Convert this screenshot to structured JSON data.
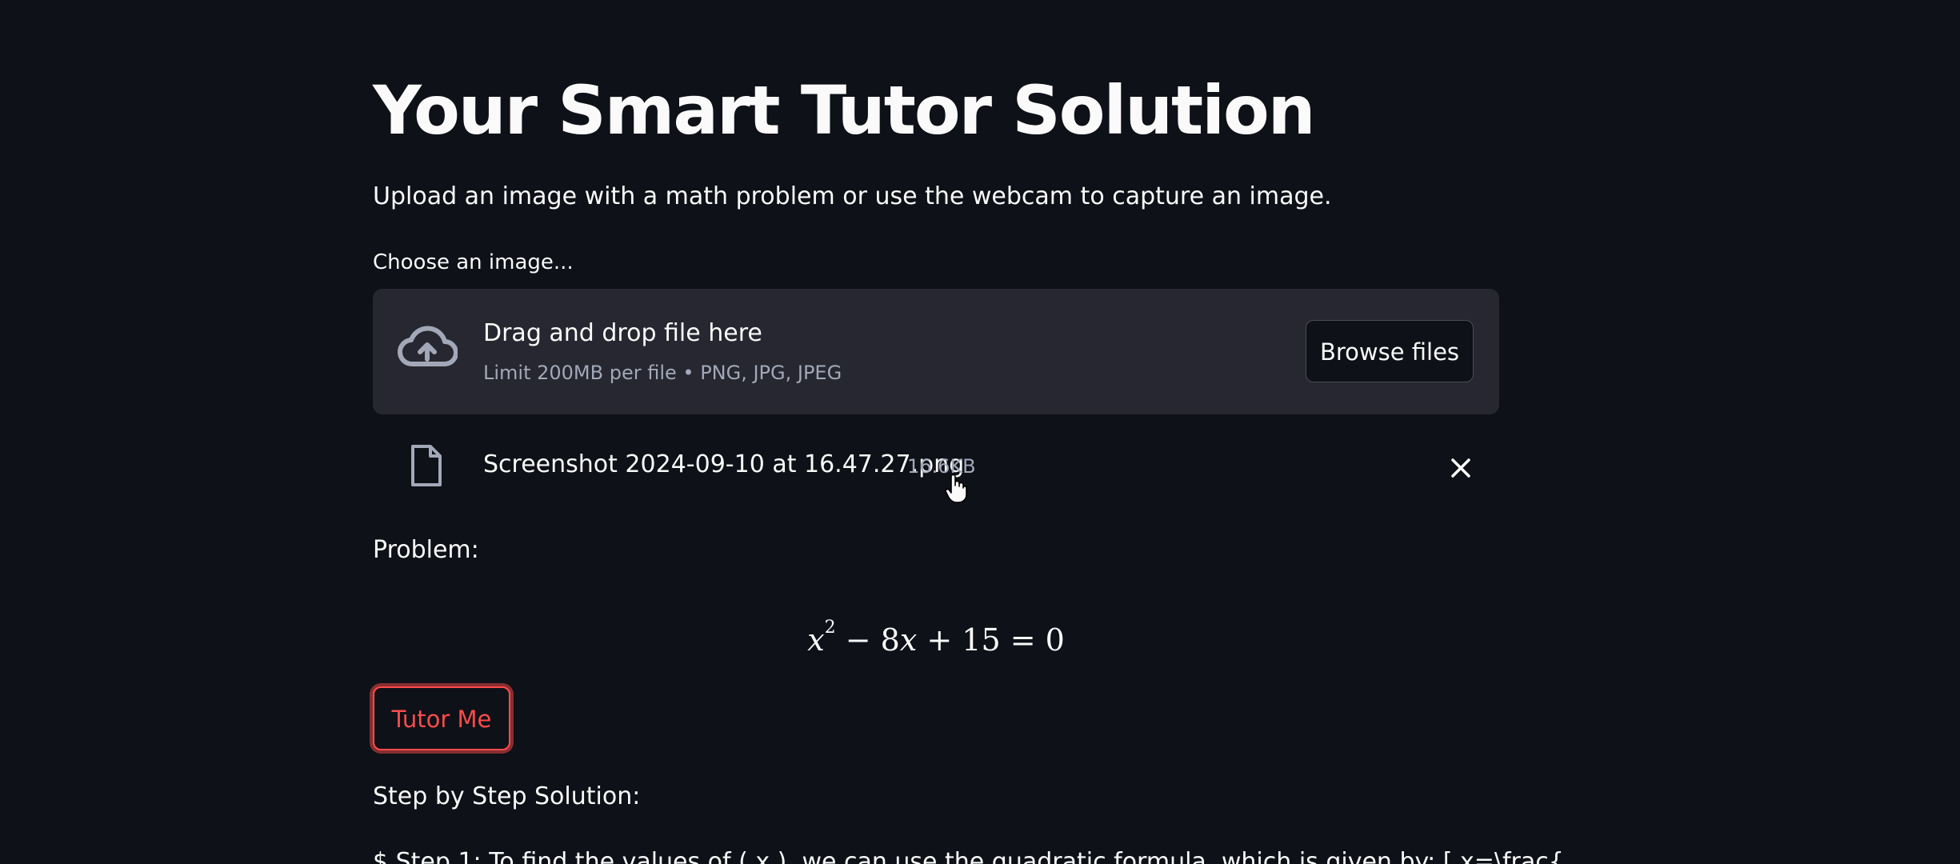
{
  "page": {
    "title": "Your Smart Tutor Solution",
    "subtitle": "Upload an image with a math problem or use the webcam to capture an image."
  },
  "uploader": {
    "label": "Choose an image...",
    "drop_title": "Drag and drop file here",
    "drop_limit": "Limit 200MB per file • PNG, JPG, JPEG",
    "browse_label": "Browse files",
    "upload_icon": "cloud-upload-icon"
  },
  "uploaded_file": {
    "name": "Screenshot 2024-09-10 at 16.47.27.png",
    "size": "16.6KB",
    "file_icon": "file-icon",
    "remove_icon": "close-icon"
  },
  "problem": {
    "label": "Problem:",
    "equation": {
      "base": "x",
      "exponent": "2",
      "rest_1": " − 8",
      "var_2": "x",
      "rest_2": " + 15 = 0"
    }
  },
  "actions": {
    "tutor_label": "Tutor Me"
  },
  "solution": {
    "label": "Step by Step Solution:",
    "step1": "$ Step 1: To find the values of ( x ), we can use the quadratic formula, which is given by: [ x=\\frac{"
  },
  "colors": {
    "background": "#0e1117",
    "panel": "#262730",
    "text": "#fafafa",
    "muted": "#a3a8b8",
    "accent": "#ff4b4b"
  }
}
